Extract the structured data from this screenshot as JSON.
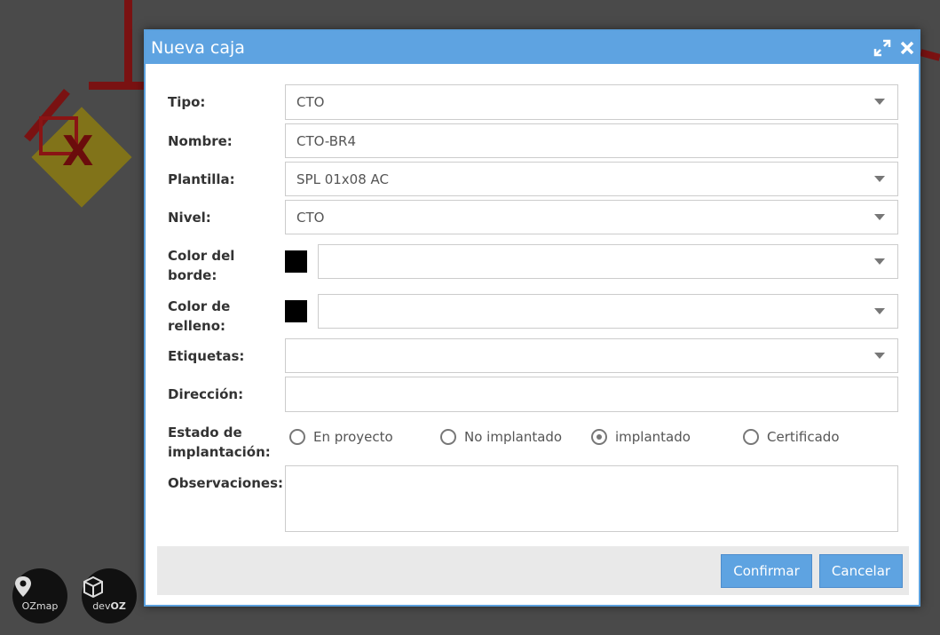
{
  "dialog": {
    "title": "Nueva caja"
  },
  "form": {
    "tipo": {
      "label": "Tipo:",
      "value": "CTO"
    },
    "nombre": {
      "label": "Nombre:",
      "value": "CTO-BR4"
    },
    "plantilla": {
      "label": "Plantilla:",
      "value": "SPL 01x08 AC"
    },
    "nivel": {
      "label": "Nivel:",
      "value": "CTO"
    },
    "color_borde": {
      "label_line1": "Color del",
      "label_line2": "borde:",
      "swatch_color": "#000000",
      "value": ""
    },
    "color_relleno": {
      "label_line1": "Color de",
      "label_line2": "relleno:",
      "swatch_color": "#000000",
      "value": ""
    },
    "etiquetas": {
      "label": "Etiquetas:",
      "value": ""
    },
    "direccion": {
      "label": "Dirección:",
      "value": ""
    },
    "estado": {
      "label_line1": "Estado de",
      "label_line2": "implantación:",
      "options": [
        "En proyecto",
        "No implantado",
        "implantado",
        "Certificado"
      ],
      "selected": "implantado"
    },
    "observaciones": {
      "label": "Observaciones:",
      "value": ""
    }
  },
  "buttons": {
    "confirm": "Confirmar",
    "cancel": "Cancelar"
  },
  "logos": {
    "ozmap": "OZmap",
    "devoz_prefix": "dev",
    "devoz_suffix": "OZ"
  },
  "colors": {
    "accent": "#5ea3e1",
    "map_line": "#7a1212"
  }
}
